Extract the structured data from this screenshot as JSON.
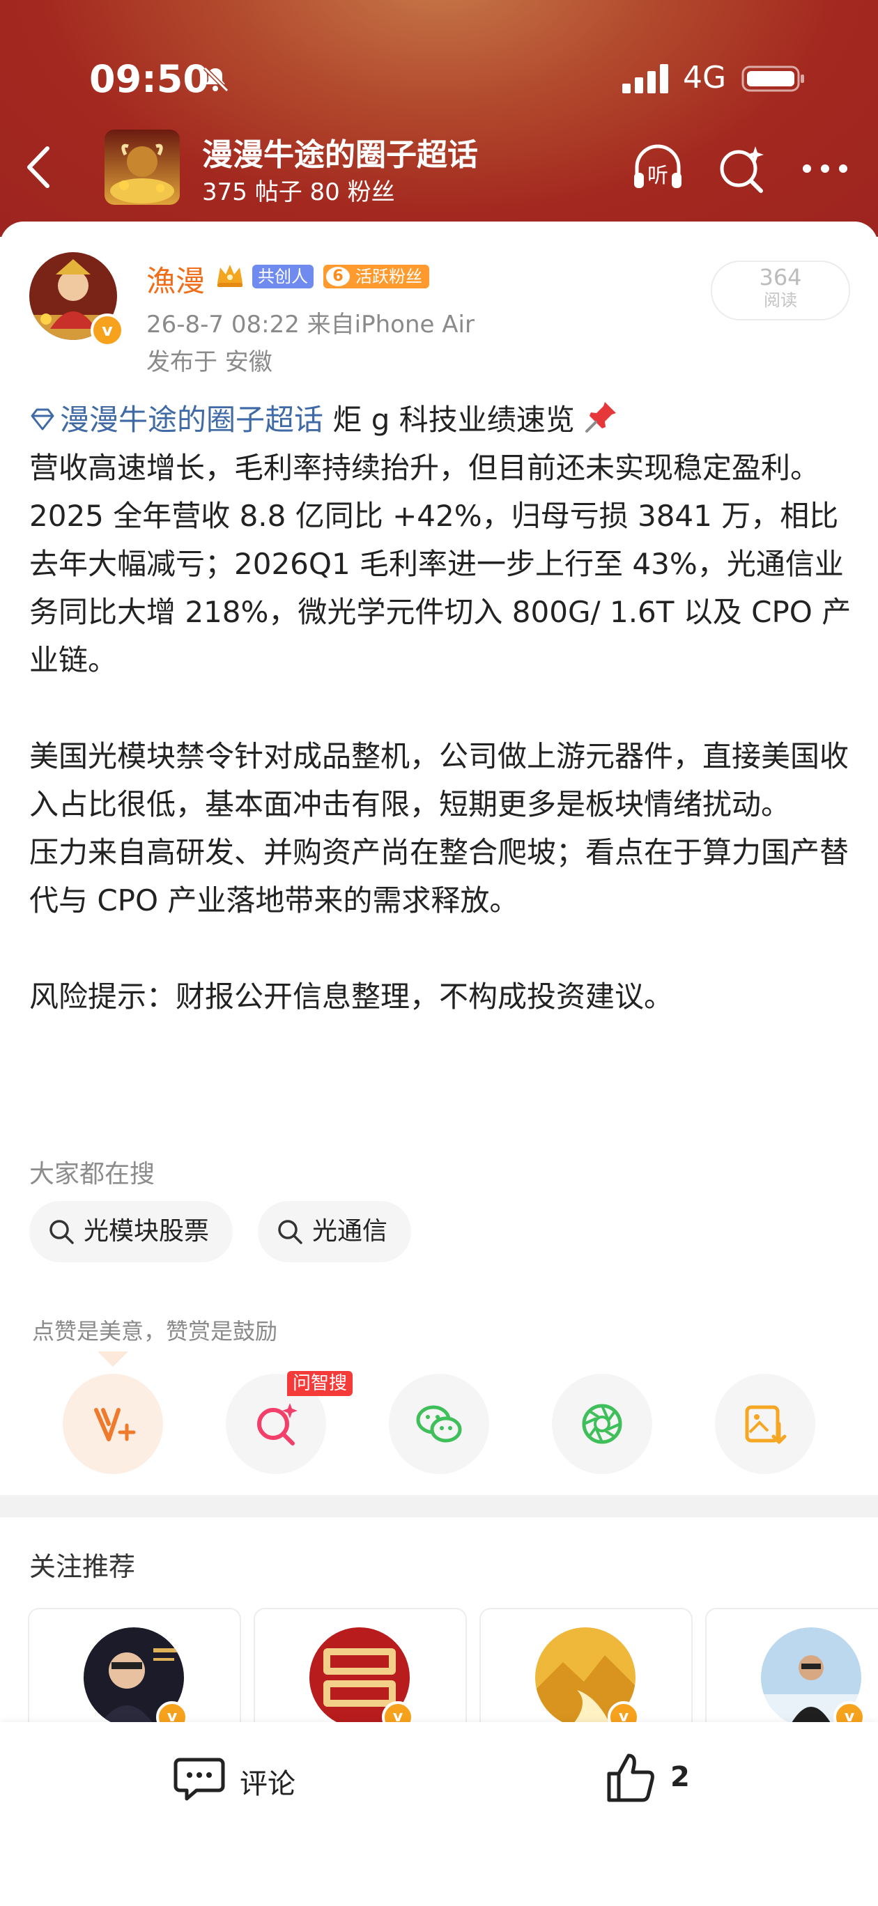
{
  "status_bar": {
    "time": "09:50",
    "network": "4G"
  },
  "header": {
    "topic_title": "漫漫牛途的圈子超话",
    "topic_stats": "375 帖子 80 粉丝",
    "icons": [
      "back-icon",
      "listen-icon",
      "search-sparkle-icon",
      "more-icon"
    ],
    "listen_glyph": "听"
  },
  "author": {
    "name": "漁漫",
    "badge_cochuang": "共创人",
    "badge_fan_level": "6",
    "badge_fan": "活跃粉丝",
    "verified_glyph": "v",
    "meta": "26-8-7 08:22  来自iPhone Air",
    "location": "发布于 安徽",
    "read_count": "364",
    "read_label": "阅读"
  },
  "post": {
    "topic_link": "漫漫牛途的圈子超话",
    "title": " 炬 g 科技业绩速览",
    "p1": "营收高速增长，毛利率持续抬升，但目前还未实现稳定盈利。",
    "p2": "2025 全年营收 8.8 亿同比 +42%，归母亏损 3841 万，相比去年大幅减亏；2026Q1 毛利率进一步上行至 43%，光通信业务同比大增 218%，微光学元件切入 800G/ 1.6T 以及 CPO 产业链。",
    "p3": "美国光模块禁令针对成品整机，公司做上游元器件，直接美国收入占比很低，基本面冲击有限，短期更多是板块情绪扰动。",
    "p4": "压力来自高研发、并购资产尚在整合爬坡；看点在于算力国产替代与 CPO 产业落地带来的需求释放。",
    "p5": "风险提示：财报公开信息整理，不构成投资建议。"
  },
  "search": {
    "heading": "大家都在搜",
    "chips": [
      "光模块股票",
      "光通信"
    ]
  },
  "reward": {
    "caption": "点赞是美意，赞赏是鼓励",
    "wenzhisou_tag": "问智搜",
    "buttons": [
      "reward-v-icon",
      "wenzhisou-icon",
      "wechat-icon",
      "moments-icon",
      "save-image-icon"
    ]
  },
  "recommend": {
    "title": "关注推荐"
  },
  "bottom_bar": {
    "comment_label": "评论",
    "like_count": "2"
  },
  "colors": {
    "header_red": "#a3281f",
    "username_orange": "#f06d1a",
    "link_blue": "#3f6aa5",
    "wenzhisou_red": "#f53a3a"
  }
}
